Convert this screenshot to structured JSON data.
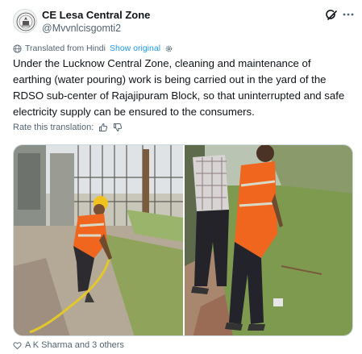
{
  "post": {
    "author_name": "CE Lesa Central Zone",
    "author_handle": "@Mvvnlcisgomti2",
    "translated_label": "Translated from Hindi",
    "show_original_label": "Show original",
    "text": "Under the Lucknow Central Zone, cleaning and maintenance of earthing (water pouring) work is being carried out in the yard of the RDSO sub-center of Rajajipuram Block, so that uninterrupted and safe electricity supply can be ensured to the consumers.",
    "rate_label": "Rate this translation:",
    "liked_by": "A K Sharma and 3 others"
  },
  "icons": {
    "avatar": "emblem-logo",
    "grok": "grok-icon",
    "more": "more-icon",
    "globe": "globe-icon",
    "settings": "gear-icon",
    "thumb_up": "thumb-up-icon",
    "thumb_down": "thumb-down-icon",
    "like": "heart-icon"
  },
  "colors": {
    "link": "#1d9bf0",
    "secondary_text": "#536471",
    "primary_text": "#0f1419"
  }
}
